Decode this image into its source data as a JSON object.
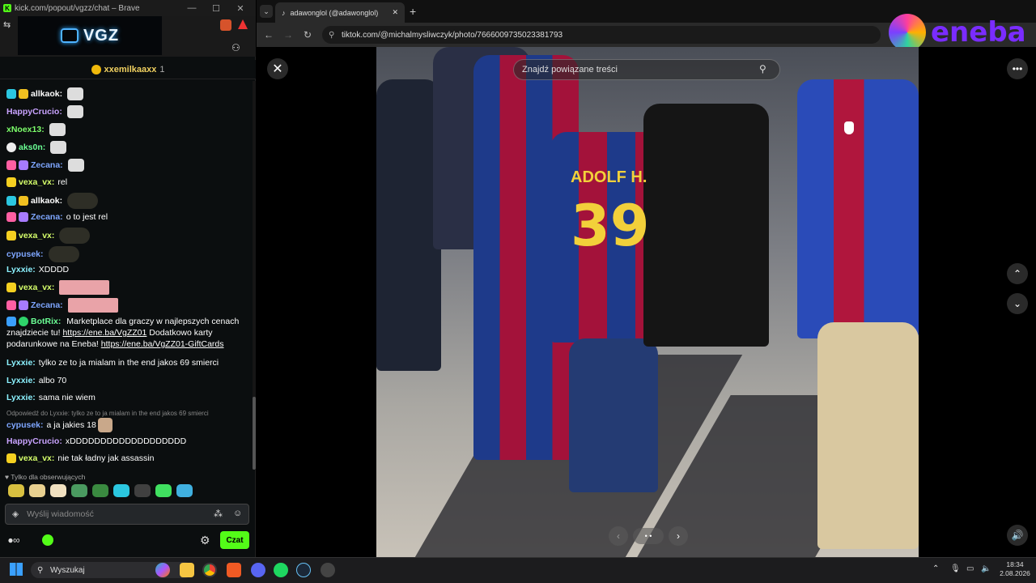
{
  "chat_window": {
    "title": "kick.com/popout/vgzz/chat – Brave",
    "banner_logo": "VGZ",
    "pinned_user": "xxemilkaaxx",
    "pinned_count": "1",
    "messages": [
      {
        "user": "allkaok:",
        "color": "#ffffff",
        "text": ""
      },
      {
        "user": "HappyCrucio:",
        "color": "#c9a3ff",
        "text": ""
      },
      {
        "user": "xNoex13:",
        "color": "#7dff6b",
        "text": ""
      },
      {
        "user": "aks0n:",
        "color": "#6bff95",
        "text": ""
      },
      {
        "user": "Zecana:",
        "color": "#7ea6ff",
        "text": ""
      },
      {
        "user": "vexa_vx:",
        "color": "#d6ff6b",
        "text": "rel"
      },
      {
        "user": "allkaok:",
        "color": "#ffffff",
        "text": ""
      },
      {
        "user": "Zecana:",
        "color": "#7ea6ff",
        "text": "o to jest rel"
      },
      {
        "user": "vexa_vx:",
        "color": "#d6ff6b",
        "text": ""
      },
      {
        "user": "cypusek:",
        "color": "#7ea6ff",
        "text": ""
      },
      {
        "user": "Lyxxie:",
        "color": "#8cf2ff",
        "text": "XDDDD"
      },
      {
        "user": "vexa_vx:",
        "color": "#d6ff6b",
        "text": ""
      },
      {
        "user": "Zecana:",
        "color": "#7ea6ff",
        "text": ""
      }
    ],
    "botrix": {
      "user": "BotRix:",
      "text1": "Marketplace dla graczy w najlepszych cenach znajdziecie tu!",
      "link1": "https://ene.ba/VgZZ01",
      "text2": "Dodatkowo karty podarunkowe na Eneba!",
      "link2": "https://ene.ba/VgZZ01-GiftCards"
    },
    "messages2": [
      {
        "user": "Lyxxie:",
        "color": "#8cf2ff",
        "text": "tylko ze to ja mialam in the end jakos 69 smierci"
      },
      {
        "user": "Lyxxie:",
        "color": "#8cf2ff",
        "text": "albo 70"
      },
      {
        "user": "Lyxxie:",
        "color": "#8cf2ff",
        "text": "sama nie wiem"
      }
    ],
    "reply_note": "Odpowiedź do Lyxxie: tylko ze to ja mialam in the end jakos 69 smierci",
    "messages3": [
      {
        "user": "cypusek:",
        "color": "#7ea6ff",
        "text": "a ja jakies 18"
      },
      {
        "user": "HappyCrucio:",
        "color": "#c9a3ff",
        "text": "xDDDDDDDDDDDDDDDDDDD"
      },
      {
        "user": "vexa_vx:",
        "color": "#d6ff6b",
        "text": "nie tak ładny jak assassin"
      }
    ],
    "followers_only": "Tylko dla obserwujących",
    "input_placeholder": "Wyślij wiadomość",
    "send_label": "Czat"
  },
  "browser": {
    "tab_title": "adawonglol (@adawonglol)",
    "url": "tiktok.com/@michalmysliwczyk/photo/7666009735023381793",
    "search_placeholder": "Znajdź powiązane treści",
    "brand": "eneba"
  },
  "taskbar": {
    "search_label": "Wyszukaj",
    "time": "18:34",
    "date": "2.08.2026"
  }
}
